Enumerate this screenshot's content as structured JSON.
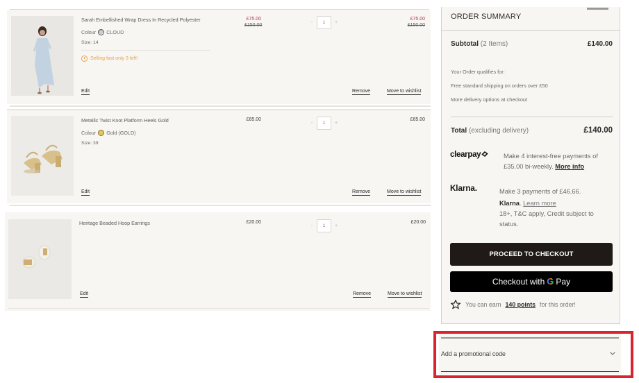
{
  "cart": {
    "items": [
      {
        "name": "Sarah Embellished Wrap Dress In Recycled Polyester",
        "colour_label": "Colour",
        "colour_value": "CLOUD",
        "size": "Size: 14",
        "stock_message": "Selling fast only 3 left!",
        "unit_price": "£75.00",
        "unit_was": "£150.00",
        "quantity": "1",
        "line_price": "£75.00",
        "line_was": "£150.00",
        "edit_label": "Edit",
        "remove_label": "Remove",
        "wishlist_label": "Move to wishlist"
      },
      {
        "name": "Metallic Twist Knot Platform Heels Gold",
        "colour_label": "Colour",
        "colour_value": "Gold (GOLD)",
        "size": "Size: 39",
        "unit_price": "£65.00",
        "quantity": "1",
        "line_price": "£65.00",
        "edit_label": "Edit",
        "remove_label": "Remove",
        "wishlist_label": "Move to wishlist"
      },
      {
        "name": "Heritage Beaded Hoop Earrings",
        "unit_price": "£20.00",
        "quantity": "1",
        "line_price": "£20.00",
        "edit_label": "Edit",
        "remove_label": "Remove",
        "wishlist_label": "Move to wishlist"
      }
    ],
    "qty_minus": "-",
    "qty_plus": "+"
  },
  "summary": {
    "title": "ORDER SUMMARY",
    "subtotal_label": "Subtotal",
    "subtotal_count": "(2 Items)",
    "subtotal_value": "£140.00",
    "delivery_lines": [
      "Your Order qualifies for:",
      "Free standard shipping on orders over £50",
      "More delivery options at checkout"
    ],
    "total_label": "Total",
    "total_note": "(excluding delivery)",
    "total_value": "£140.00",
    "clearpay": {
      "logo": "clearpay",
      "text": "Make 4 interest-free payments of £35.00 bi-weekly.",
      "link": "More info"
    },
    "klarna": {
      "logo": "Klarna.",
      "line1": "Make 3 payments of £46.66.",
      "brand": "Klarna",
      "link": "Learn more",
      "line3": "18+, T&C apply, Credit subject to status."
    },
    "checkout_button": "PROCEED TO CHECKOUT",
    "gpay_prefix": "Checkout with",
    "gpay_g": "G",
    "gpay_suffix": "Pay",
    "points_prefix": "You can earn",
    "points_value": "140 points",
    "points_suffix": "for this order!"
  },
  "promo": {
    "label": "Add a promotional code"
  },
  "colors": {
    "sale_price": "#b33a4a",
    "low_stock": "#e8a24a",
    "checkout_button": "#1f1a17",
    "highlight": "#d9232f"
  }
}
